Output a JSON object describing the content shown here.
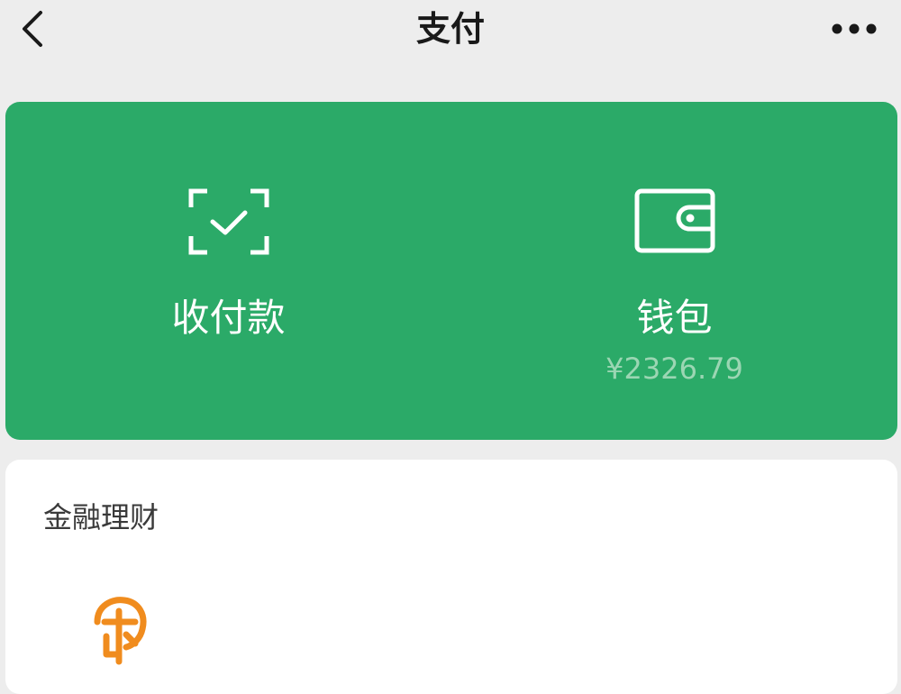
{
  "nav": {
    "title": "支付",
    "back_icon": "chevron-left-icon",
    "more_icon": "more-dots-icon"
  },
  "payment_card": {
    "background_color": "#2baa68",
    "items": [
      {
        "label": "收付款",
        "icon": "scan-check-icon"
      },
      {
        "label": "钱包",
        "icon": "wallet-icon",
        "balance": "¥2326.79"
      }
    ]
  },
  "finance": {
    "title": "金融理财",
    "items": [
      {
        "icon": "licaitong-icon",
        "icon_color": "#f08c1e"
      }
    ]
  }
}
